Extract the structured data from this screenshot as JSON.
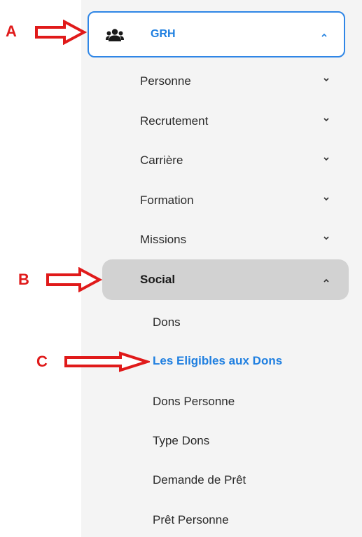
{
  "markers": {
    "a": "A",
    "b": "B",
    "c": "C"
  },
  "grh": {
    "label": "GRH",
    "icon": "users-icon",
    "expanded": true
  },
  "menu": [
    {
      "label": "Personne"
    },
    {
      "label": "Recrutement"
    },
    {
      "label": "Carrière"
    },
    {
      "label": "Formation"
    },
    {
      "label": "Missions"
    }
  ],
  "social": {
    "label": "Social",
    "expanded": true,
    "items": [
      {
        "label": "Dons"
      },
      {
        "label": "Les Eligibles aux Dons",
        "active": true
      },
      {
        "label": "Dons Personne"
      },
      {
        "label": "Type Dons"
      },
      {
        "label": "Demande de Prêt"
      },
      {
        "label": "Prêt Personne"
      }
    ]
  },
  "colors": {
    "accent": "#1f7fe0",
    "annotation": "#e01a1a",
    "selected_bg": "#d2d2d2"
  }
}
